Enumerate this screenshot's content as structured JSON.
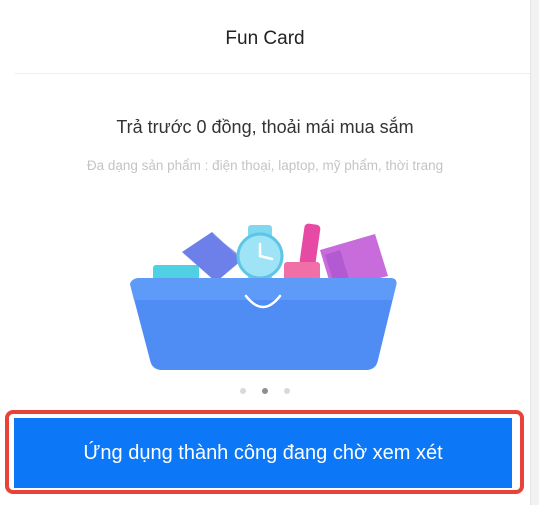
{
  "header": {
    "title": "Fun Card"
  },
  "promo": {
    "headline": "Trả trước 0 đồng, thoải mái mua sắm",
    "subline": "Đa dạng sản phẩm : điện thoại, laptop, mỹ phẩm, thời trang",
    "illustration": "shopping-basket-illustration",
    "carousel_total": 3,
    "carousel_active_index": 2
  },
  "cta": {
    "label": "Ứng dụng thành công đang chờ xem xét"
  },
  "colors": {
    "accent": "#0d78f7",
    "highlight_border": "#e8433a",
    "basket": "#4f8df4",
    "subtext": "#c4c4c4"
  }
}
